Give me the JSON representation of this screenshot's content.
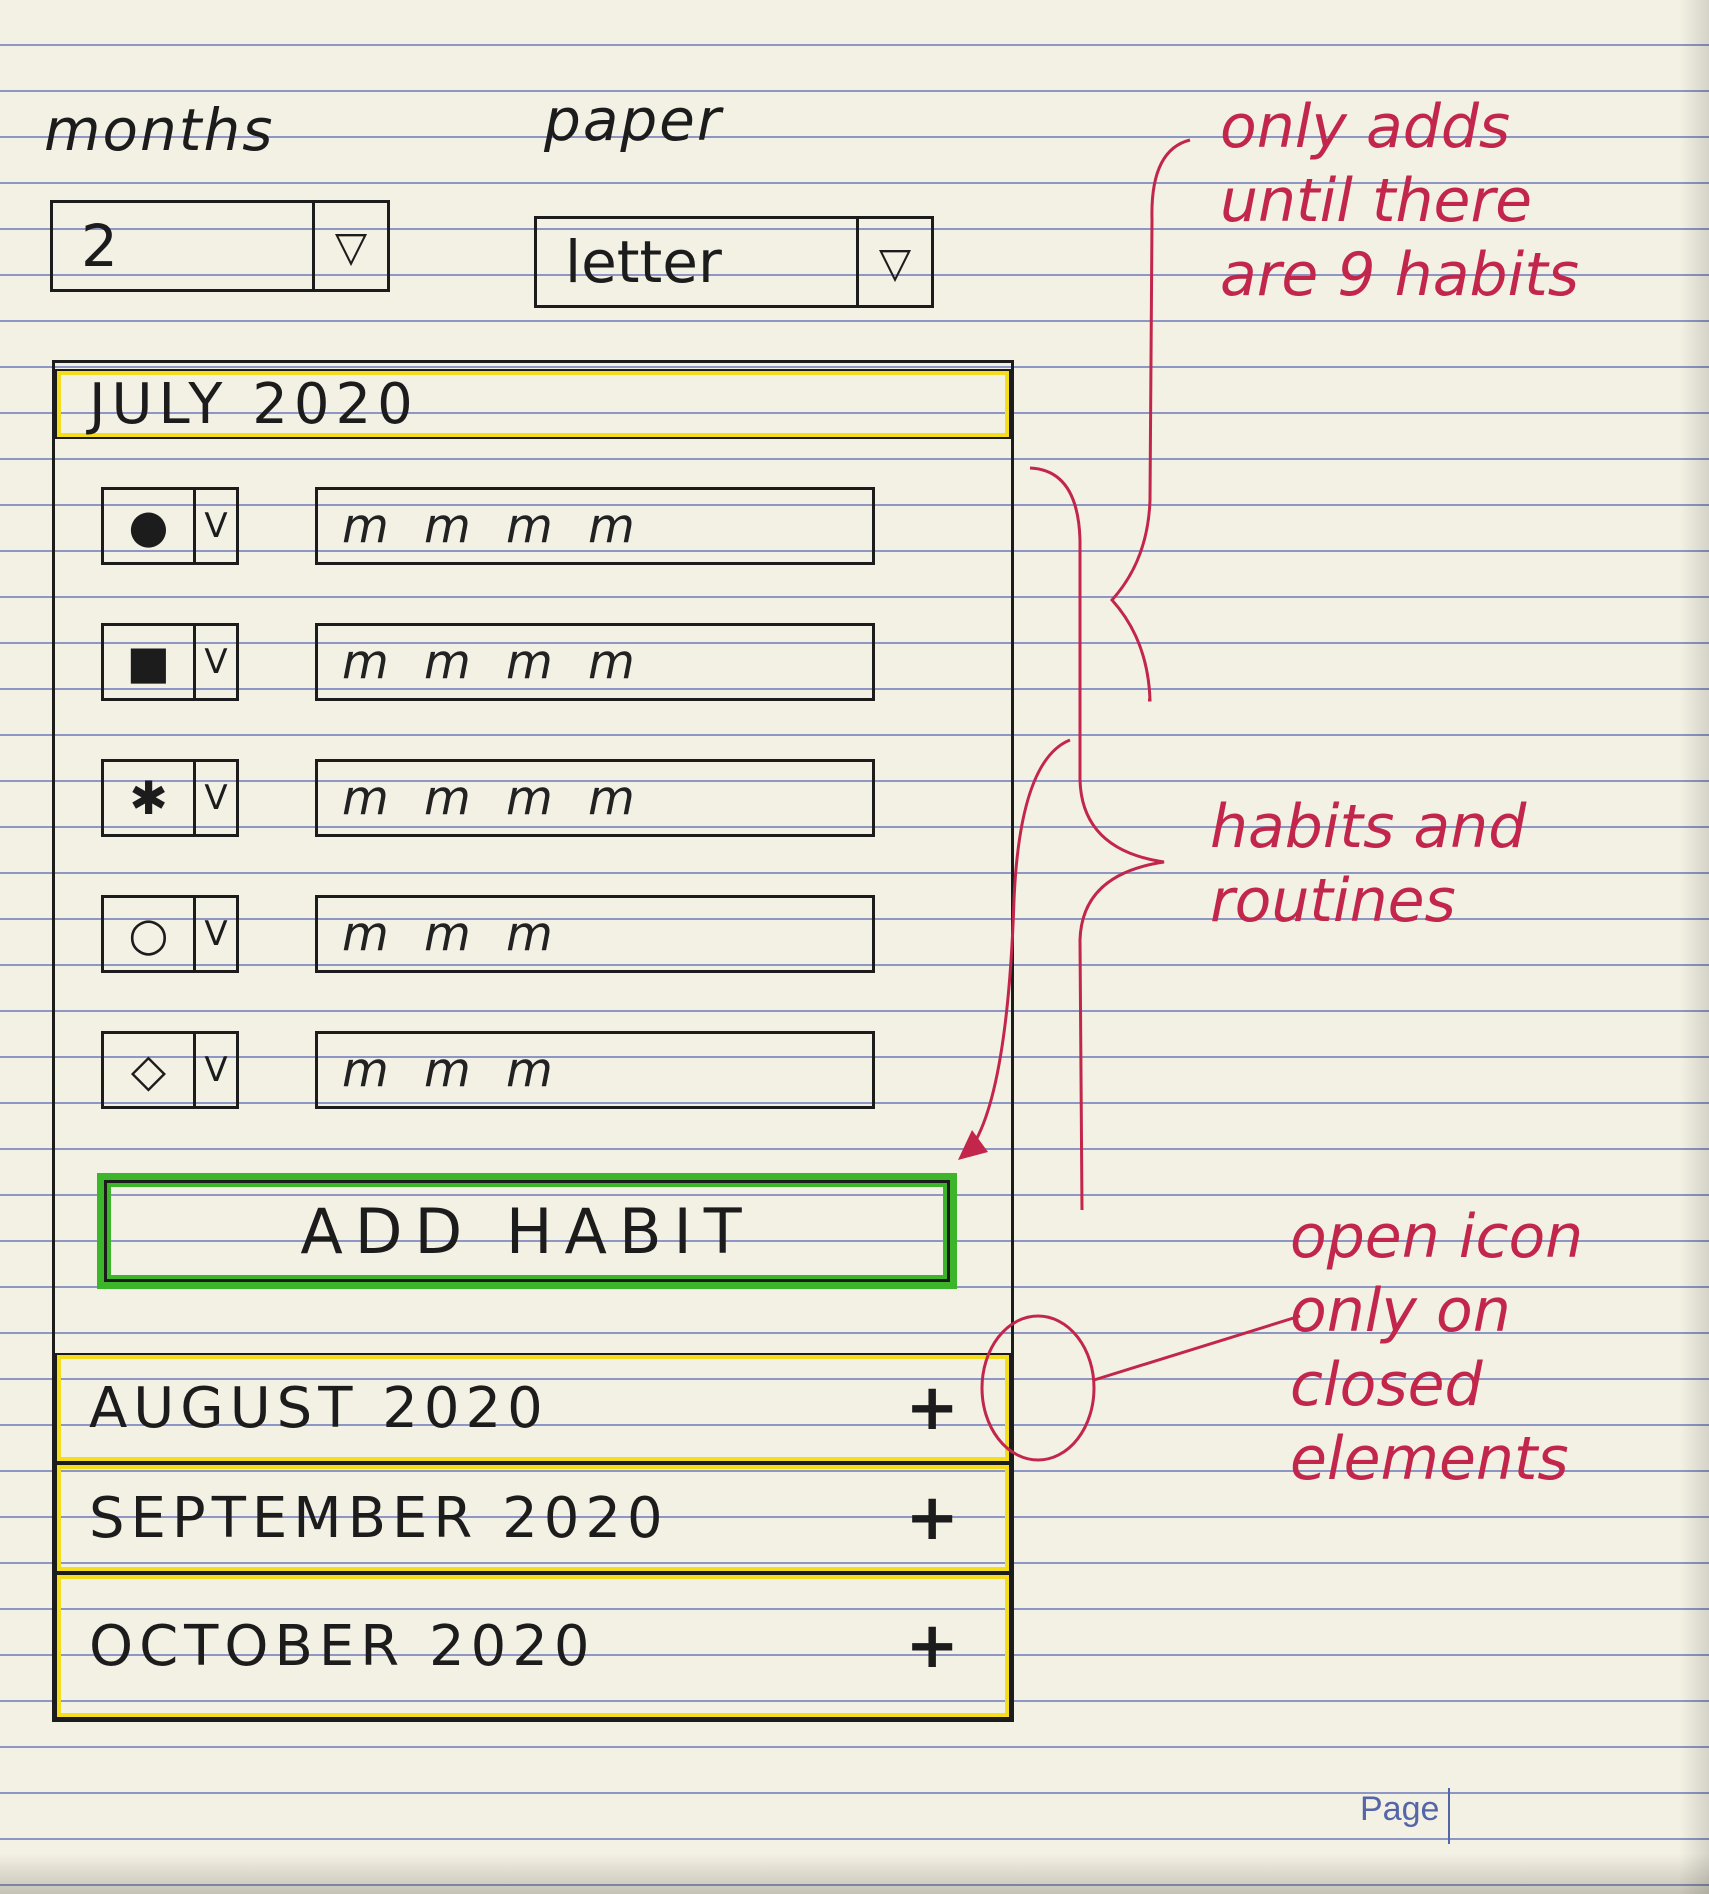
{
  "controls": {
    "months_label": "months",
    "months_value": "2",
    "paper_label": "paper",
    "paper_value": "letter",
    "dropdown_glyph": "▽"
  },
  "open_month": {
    "title": "JULY 2020",
    "habits": [
      {
        "icon": "filled-circle-icon",
        "glyph": "●",
        "dropdown": "V",
        "text": "m m m m"
      },
      {
        "icon": "filled-square-icon",
        "glyph": "■",
        "dropdown": "V",
        "text": "m m m m"
      },
      {
        "icon": "star-icon",
        "glyph": "✱",
        "dropdown": "V",
        "text": "m m m m"
      },
      {
        "icon": "circle-icon",
        "glyph": "○",
        "dropdown": "V",
        "text": "m m m"
      },
      {
        "icon": "diamond-icon",
        "glyph": "◇",
        "dropdown": "V",
        "text": "m m m"
      }
    ],
    "add_habit_label": "ADD HABIT"
  },
  "closed_months": [
    {
      "title": "AUGUST 2020",
      "icon": "+"
    },
    {
      "title": "SEPTEMBER 2020",
      "icon": "+"
    },
    {
      "title": "OCTOBER 2020",
      "icon": "+"
    }
  ],
  "annotations": {
    "note_1": "only adds until there are 9 habits",
    "note_2": "habits and routines",
    "note_3": "open icon only on closed elements"
  },
  "page_label": "Page",
  "colors": {
    "highlight_yellow": "#f4dc1f",
    "highlight_green": "#3cb52a",
    "annotation_red": "#c2264a",
    "ruled_line": "#8d96c4"
  }
}
